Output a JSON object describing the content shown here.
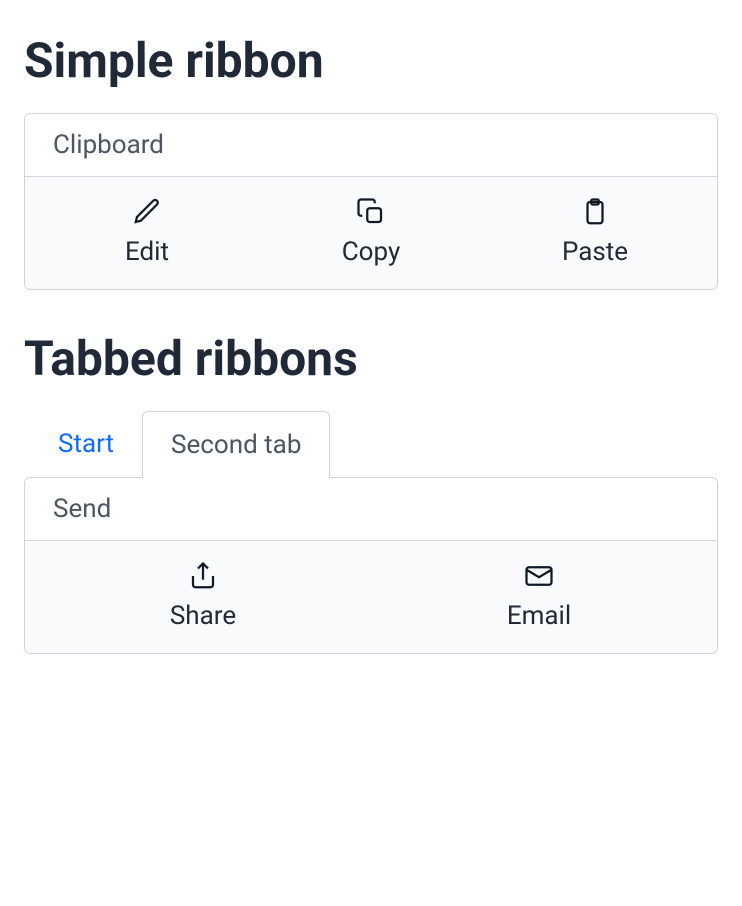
{
  "simple": {
    "title": "Simple ribbon",
    "header": "Clipboard",
    "items": [
      {
        "label": "Edit"
      },
      {
        "label": "Copy"
      },
      {
        "label": "Paste"
      }
    ]
  },
  "tabbed": {
    "title": "Tabbed ribbons",
    "tabs": [
      {
        "label": "Start"
      },
      {
        "label": "Second tab"
      }
    ],
    "header": "Send",
    "items": [
      {
        "label": "Share"
      },
      {
        "label": "Email"
      }
    ]
  }
}
